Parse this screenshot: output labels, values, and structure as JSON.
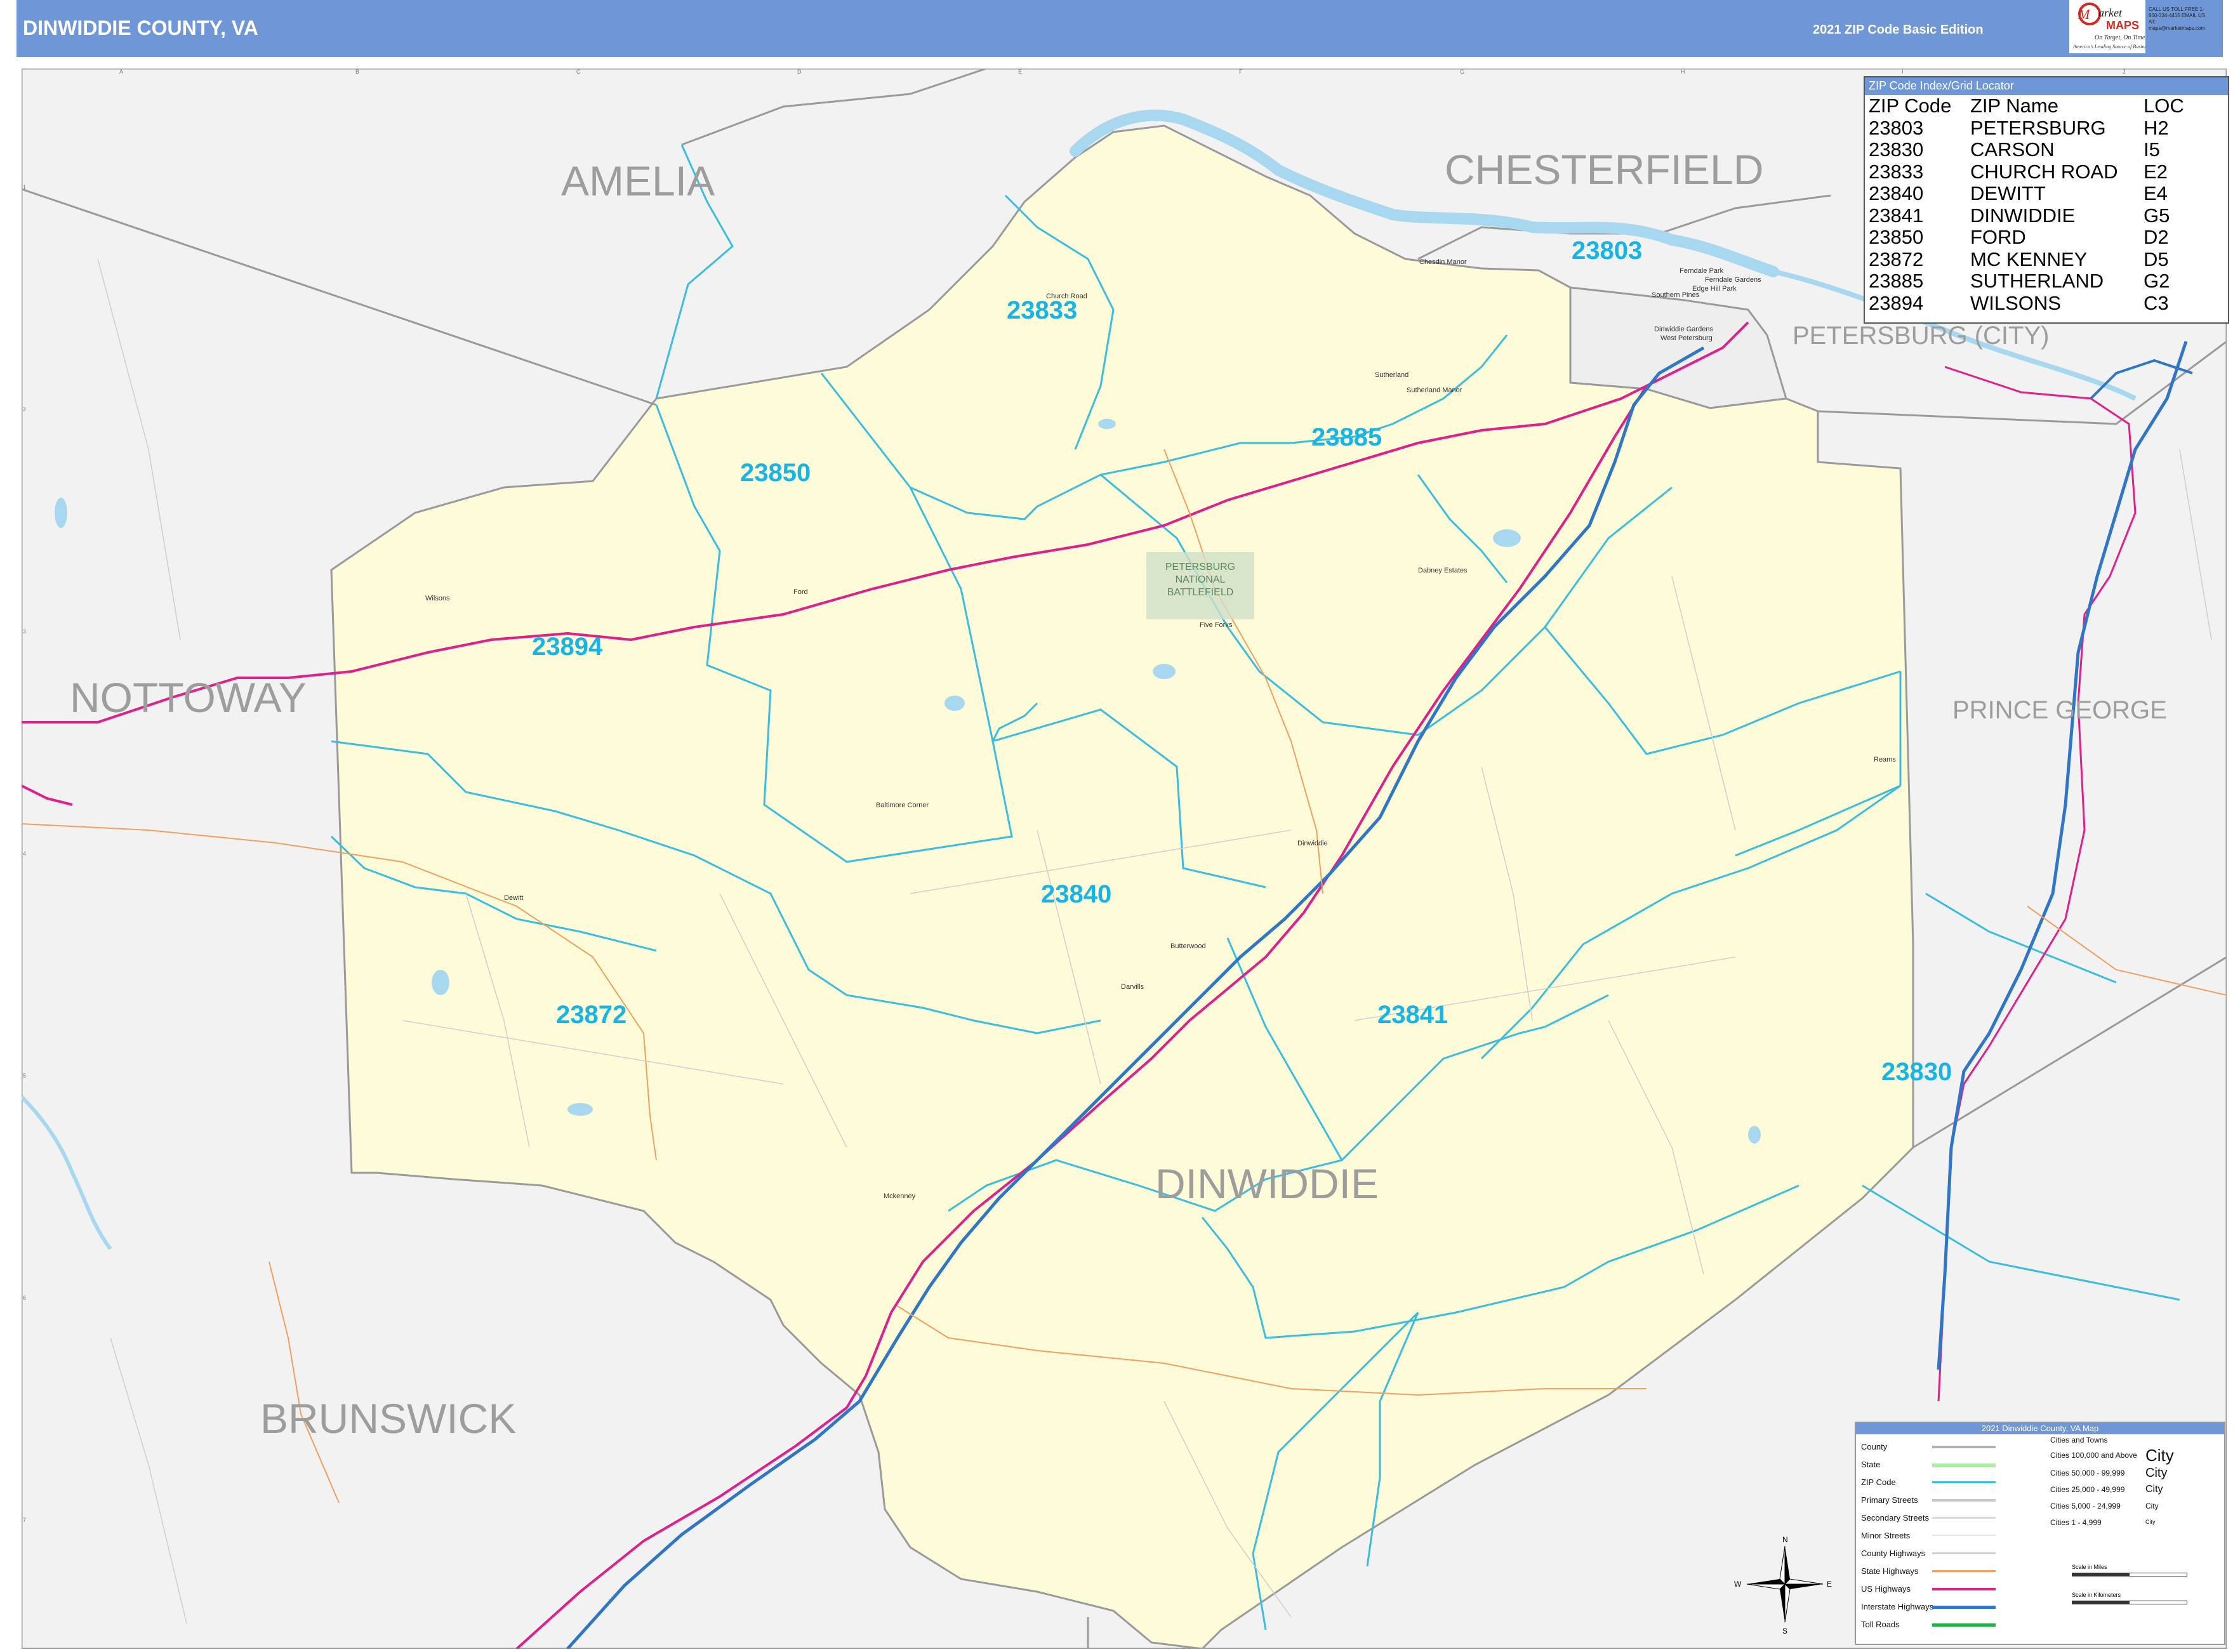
{
  "header": {
    "title": "DINWIDDIE COUNTY, VA",
    "edition": "2021 ZIP Code Basic Edition",
    "logo_text": "Market MAPS",
    "logo_tagline": "On Target, On Time",
    "logo_subline": "America's Leading Source of Business Maps",
    "contact": "CALL US TOLL FREE 1-800-334-4415  EMAIL US AT: maps@marketmaps.com"
  },
  "grid": {
    "columns": [
      "A",
      "B",
      "C",
      "D",
      "E",
      "F",
      "G",
      "H",
      "I",
      "J"
    ],
    "rows": [
      "1",
      "2",
      "3",
      "4",
      "5",
      "6",
      "7"
    ]
  },
  "counties": {
    "amelia": "AMELIA",
    "chesterfield": "CHESTERFIELD",
    "petersburg": "PETERSBURG (CITY)",
    "nottoway": "NOTTOWAY",
    "prince_george": "PRINCE GEORGE",
    "brunswick": "BRUNSWICK",
    "dinwiddie": "DINWIDDIE"
  },
  "zip_labels": {
    "z23803": "23803",
    "z23833": "23833",
    "z23850": "23850",
    "z23885": "23885",
    "z23894": "23894",
    "z23840": "23840",
    "z23841": "23841",
    "z23872": "23872",
    "z23830": "23830"
  },
  "park": {
    "line1": "PETERSBURG",
    "line2": "NATIONAL",
    "line3": "BATTLEFIELD"
  },
  "places": {
    "church_road": "Church Road",
    "chesdin_manor": "Chesdin Manor",
    "ferndale_park": "Ferndale Park",
    "ferndale_gardens": "Ferndale Gardens",
    "edge_hill_park": "Edge Hill Park",
    "southern_pines": "Southern Pines",
    "dinwiddie_gardens": "Dinwiddie Gardens",
    "west_petersburg": "West Petersburg",
    "sutherland": "Sutherland",
    "sutherland_manor": "Sutherland Manor",
    "ford": "Ford",
    "wilsons": "Wilsons",
    "five_forks": "Five Forks",
    "dabney_estates": "Dabney Estates",
    "baltimore_corner": "Baltimore Corner",
    "dinwiddie": "Dinwiddie",
    "butterwood": "Butterwood",
    "darvills": "Darvills",
    "dewitt": "Dewitt",
    "mckenney": "Mckenney",
    "reams": "Reams"
  },
  "zip_index": {
    "header": "ZIP Code Index/Grid Locator",
    "columns": [
      "ZIP Code",
      "ZIP Name",
      "LOC"
    ],
    "rows": [
      [
        "23803",
        "PETERSBURG",
        "H2"
      ],
      [
        "23830",
        "CARSON",
        "I5"
      ],
      [
        "23833",
        "CHURCH ROAD",
        "E2"
      ],
      [
        "23840",
        "DEWITT",
        "E4"
      ],
      [
        "23841",
        "DINWIDDIE",
        "G5"
      ],
      [
        "23850",
        "FORD",
        "D2"
      ],
      [
        "23872",
        "MC KENNEY",
        "D5"
      ],
      [
        "23885",
        "SUTHERLAND",
        "G2"
      ],
      [
        "23894",
        "WILSONS",
        "C3"
      ]
    ]
  },
  "legend": {
    "header": "2021 Dinwiddie County, VA Map",
    "cities_header": "Cities and Towns",
    "items": [
      "County",
      "State",
      "ZIP Code",
      "Primary Streets",
      "Secondary Streets",
      "Minor Streets",
      "County Highways",
      "State Highways",
      "US Highways",
      "Interstate Highways",
      "Toll Roads"
    ],
    "city_classes": [
      {
        "range": "Cities 100,000 and Above",
        "sample": "City"
      },
      {
        "range": "Cities 50,000 - 99,999",
        "sample": "City"
      },
      {
        "range": "Cities 25,000 - 49,999",
        "sample": "City"
      },
      {
        "range": "Cities 5,000 - 24,999",
        "sample": "City"
      },
      {
        "range": "Cities 1 - 4,999",
        "sample": "City"
      }
    ],
    "scale_miles": "Scale in Miles",
    "scale_km": "Scale in Kilometers"
  },
  "compass": {
    "n": "N",
    "s": "S",
    "e": "E",
    "w": "W"
  },
  "colors": {
    "header": "#6f96d6",
    "county_fill": "#fdfbd8",
    "outside": "#f2f2f2",
    "zip_line": "#3bbde0",
    "zip_label": "#18b4e6",
    "us_highway": "#e0208a",
    "interstate": "#2f76c8",
    "water": "#a8d8f0",
    "county_border": "#9a9a9a"
  }
}
